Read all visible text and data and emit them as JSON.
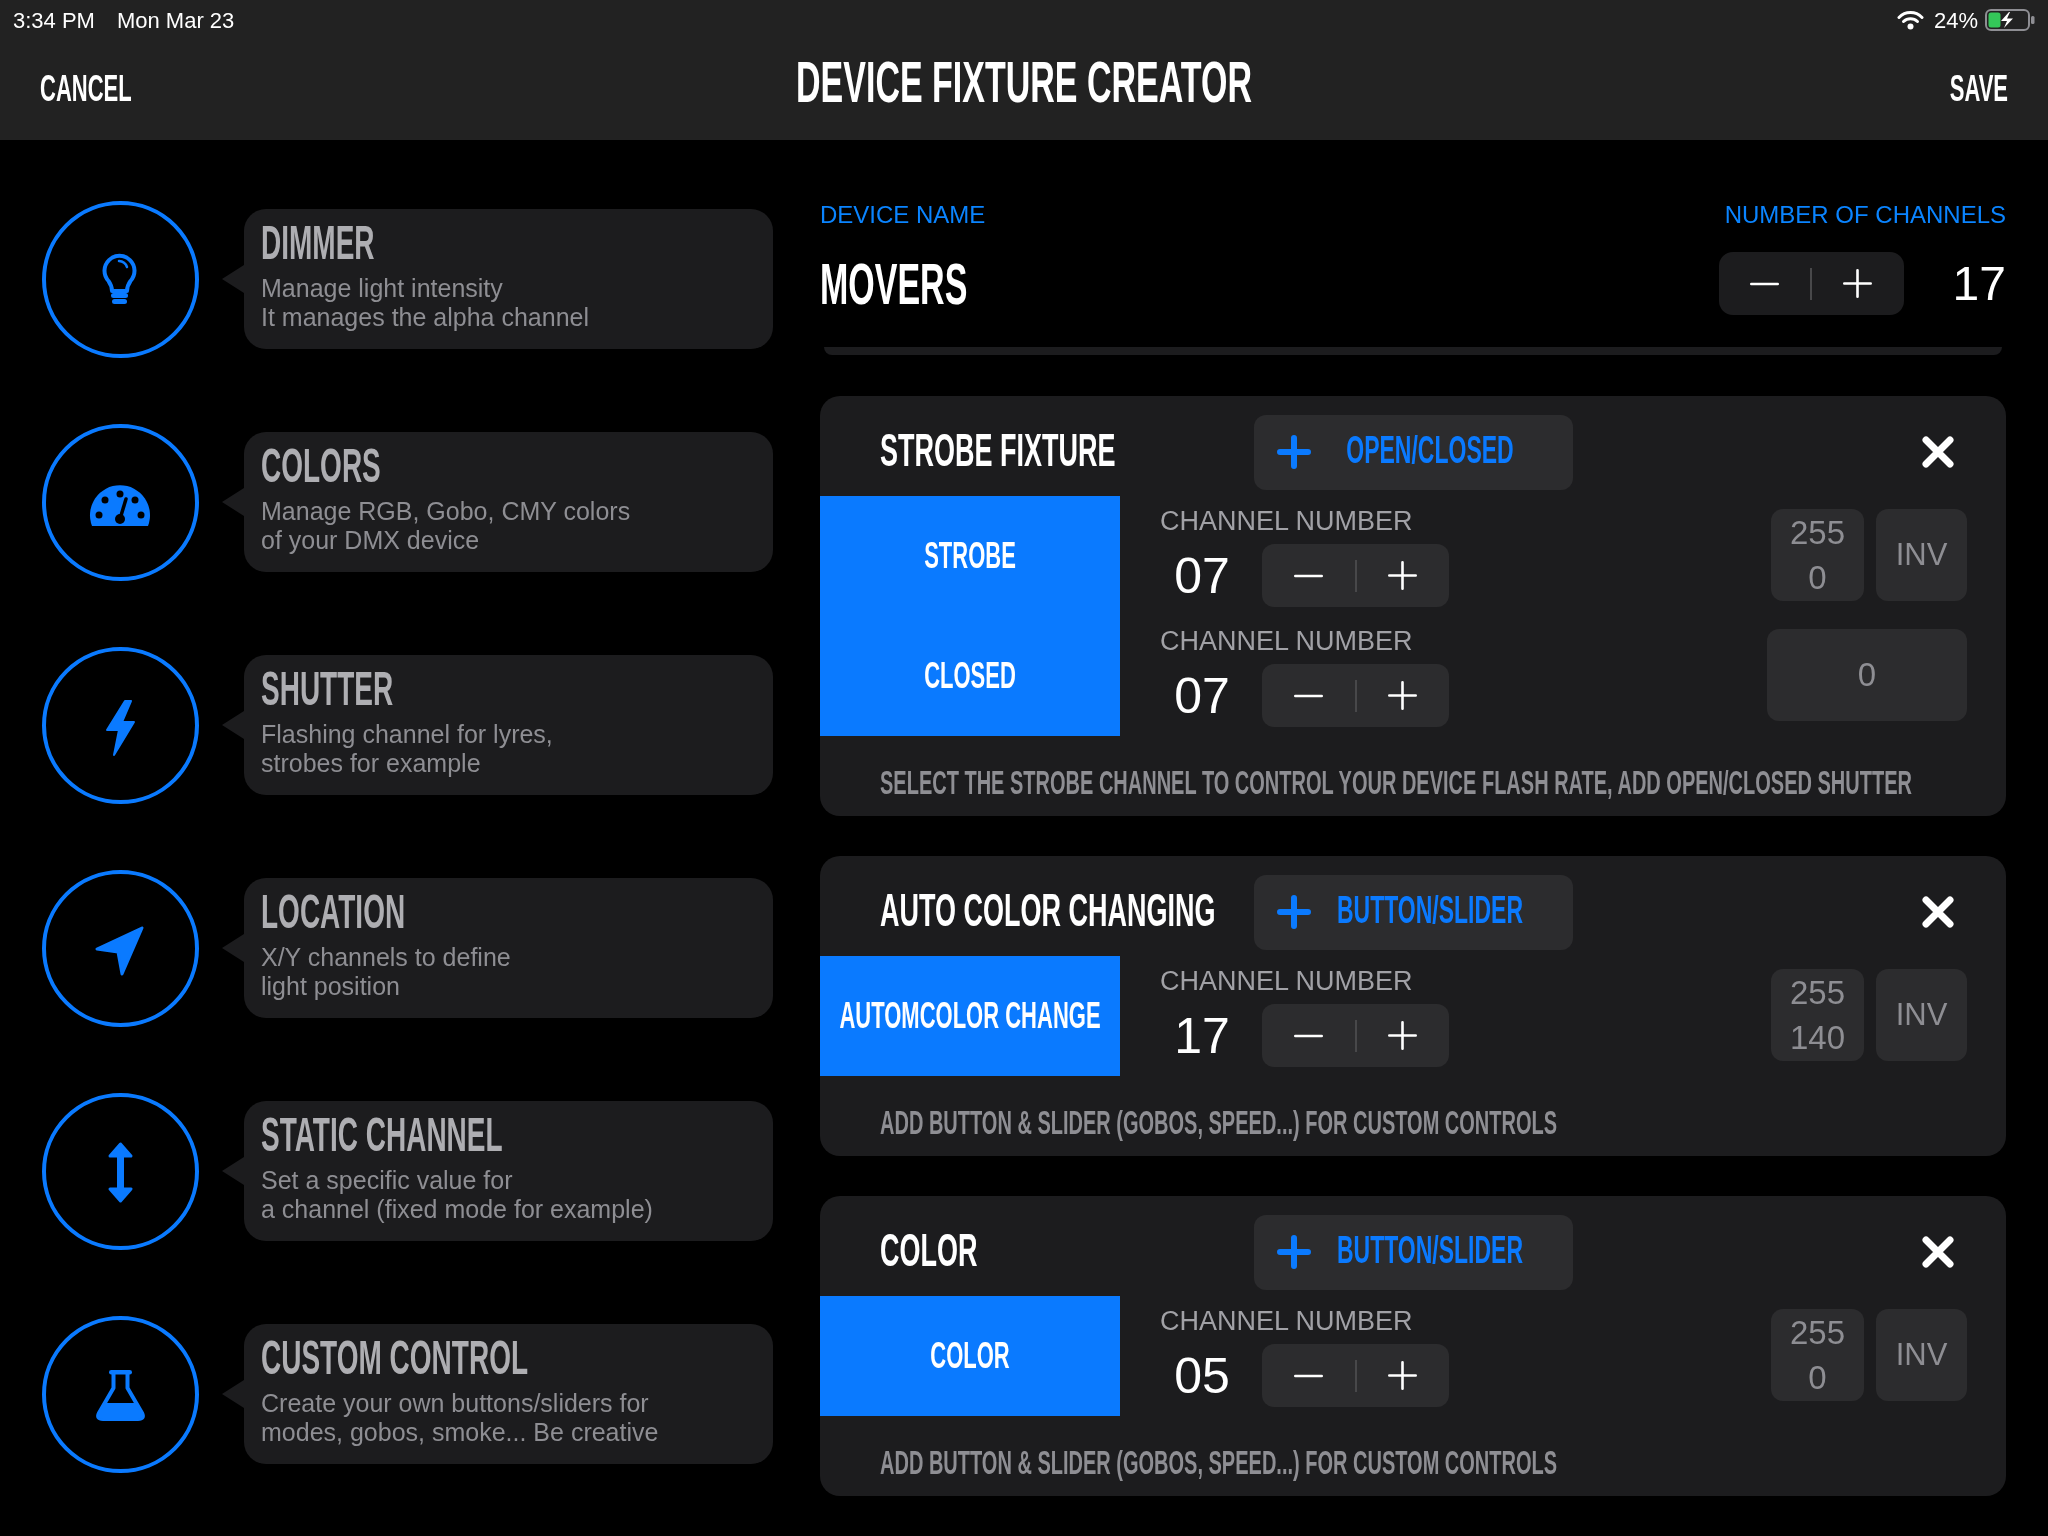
{
  "status_bar": {
    "time": "3:34 PM",
    "date": "Mon Mar 23",
    "battery": "24%",
    "charging": true
  },
  "nav_bar": {
    "cancel": "CANCEL",
    "title": "DEVICE FIXTURE CREATOR",
    "save": "SAVE"
  },
  "palette": [
    {
      "kind": "dimmer",
      "title": "DIMMER",
      "description": "Manage light intensity\nIt manages the alpha channel"
    },
    {
      "kind": "colors",
      "title": "COLORS",
      "description": "Manage RGB, Gobo, CMY colors\nof your DMX device"
    },
    {
      "kind": "shutter",
      "title": "SHUTTER",
      "description": "Flashing channel for lyres,\nstrobes for example"
    },
    {
      "kind": "location",
      "title": "LOCATION",
      "description": "X/Y channels to define\nlight position"
    },
    {
      "kind": "static",
      "title": "STATIC CHANNEL",
      "description": "Set a specific value for\na channel (fixed mode for example)"
    },
    {
      "kind": "custom",
      "title": "CUSTOM CONTROL",
      "description": "Create your own buttons/sliders for\nmodes, gobos, smoke... Be creative"
    }
  ],
  "device": {
    "name_label": "DEVICE NAME",
    "name": "MOVERS",
    "channels_label": "NUMBER OF CHANNELS",
    "channels": "17"
  },
  "fixtures": [
    {
      "title": "STROBE FIXTURE",
      "add_button": "OPEN/CLOSED",
      "channels": [
        {
          "kind": "range",
          "label": "STROBE",
          "number_label": "CHANNEL NUMBER",
          "number": "07",
          "max": "255",
          "min": "0",
          "invert": "INV"
        },
        {
          "kind": "value",
          "label": "CLOSED",
          "number_label": "CHANNEL NUMBER",
          "number": "07",
          "value": "0"
        }
      ],
      "hint": "SELECT THE STROBE CHANNEL TO CONTROL YOUR DEVICE FLASH RATE, ADD OPEN/CLOSED SHUTTER"
    },
    {
      "title": "AUTO COLOR CHANGING",
      "add_button": "BUTTON/SLIDER",
      "channels": [
        {
          "kind": "range",
          "label": "AUTOMCOLOR CHANGE",
          "number_label": "CHANNEL NUMBER",
          "number": "17",
          "max": "255",
          "min": "140",
          "invert": "INV"
        }
      ],
      "hint": "ADD BUTTON & SLIDER (GOBOS, SPEED...) FOR CUSTOM CONTROLS"
    },
    {
      "title": "COLOR",
      "add_button": "BUTTON/SLIDER",
      "channels": [
        {
          "kind": "range",
          "label": "COLOR",
          "number_label": "CHANNEL NUMBER",
          "number": "05",
          "max": "255",
          "min": "0",
          "invert": "INV"
        }
      ],
      "hint": "ADD BUTTON & SLIDER (GOBOS, SPEED...) FOR CUSTOM CONTROLS"
    }
  ]
}
